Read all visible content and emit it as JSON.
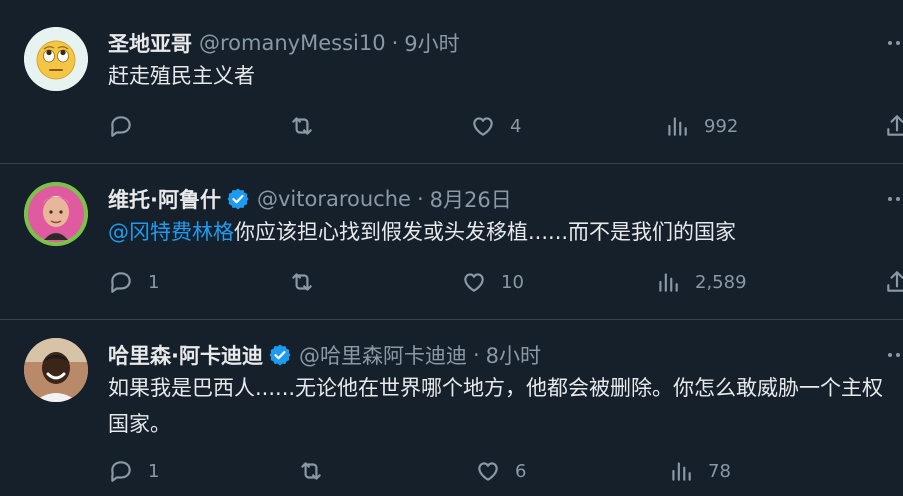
{
  "tweets": [
    {
      "name": "圣地亚哥",
      "handle": "@romanyMessi10",
      "time": "9小时",
      "text": "赶走殖民主义者",
      "mention": "",
      "verified": false,
      "replies": "",
      "likes": "4",
      "views": "992"
    },
    {
      "name": "维托·阿鲁什",
      "handle": "@vitorarouche",
      "time": "8月26日",
      "text": "你应该担心找到假发或头发移植......而不是我们的国家",
      "mention": "@冈特费林格",
      "verified": true,
      "replies": "1",
      "likes": "10",
      "views": "2,589"
    },
    {
      "name": "哈里森·阿卡迪迪",
      "handle": "@哈里森阿卡迪迪",
      "time": "8小时",
      "text": "如果我是巴西人......无论他在世界哪个地方，他都会被删除。你怎么敢威胁一个主权国家。",
      "mention": "",
      "verified": true,
      "replies": "1",
      "likes": "6",
      "views": "78"
    }
  ],
  "separator": "·",
  "colors": {
    "background": "#15202b",
    "accent": "#1d9bf0",
    "muted": "#8b98a5",
    "text": "#e7e9ea"
  },
  "icons": [
    "reply-icon",
    "retweet-icon",
    "like-icon",
    "views-icon",
    "share-icon",
    "more-icon",
    "verified-icon"
  ]
}
